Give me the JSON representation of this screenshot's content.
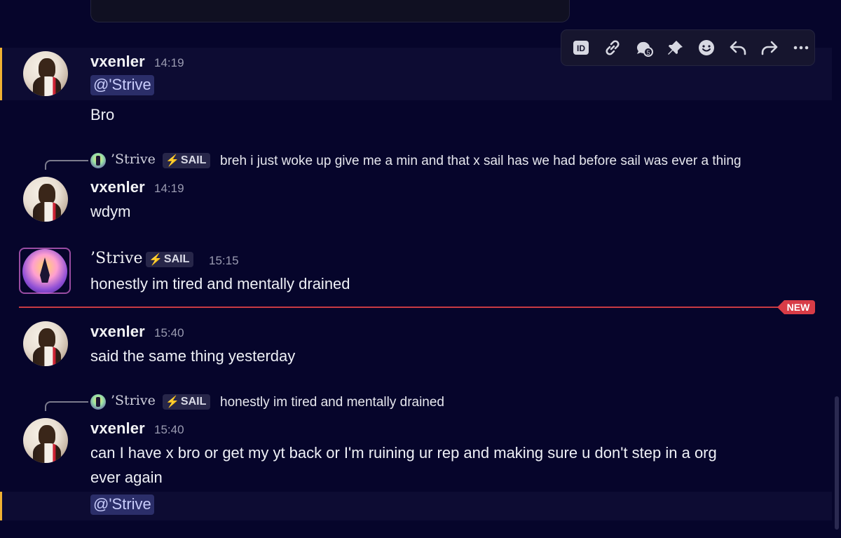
{
  "toolbar": {
    "buttons": [
      "id-icon",
      "link-icon",
      "thread-icon",
      "pin-icon",
      "emoji-icon",
      "reply-icon",
      "forward-icon",
      "more-icon"
    ]
  },
  "messages": [
    {
      "username": "vxenler",
      "time": "14:19",
      "mention": "@'Strive",
      "text": "Bro"
    },
    {
      "reply": {
        "name": "’Strive",
        "tag": "SAIL",
        "text": "breh i just woke up give me a min and that x sail has we had before sail was ever a thing"
      },
      "username": "vxenler",
      "time": "14:19",
      "text": "wdym"
    },
    {
      "username": "’Strive",
      "tag": "SAIL",
      "time": "15:15",
      "text": "honestly im tired and mentally drained"
    },
    {
      "username": "vxenler",
      "time": "15:40",
      "text": "said the same thing yesterday"
    },
    {
      "reply": {
        "name": "’Strive",
        "tag": "SAIL",
        "text": "honestly im tired and mentally drained"
      },
      "username": "vxenler",
      "time": "15:40",
      "text_line1": "can I have x bro or get my yt back or I'm ruining ur rep and making sure u don't step in a org",
      "text_line2": "ever again",
      "mention": "@'Strive"
    }
  ],
  "divider": {
    "label": "NEW"
  },
  "colors": {
    "background": "#06052b",
    "mention_highlight": "#0d0c33",
    "mention_bar": "#f0b232",
    "new_divider": "#d83c47"
  }
}
